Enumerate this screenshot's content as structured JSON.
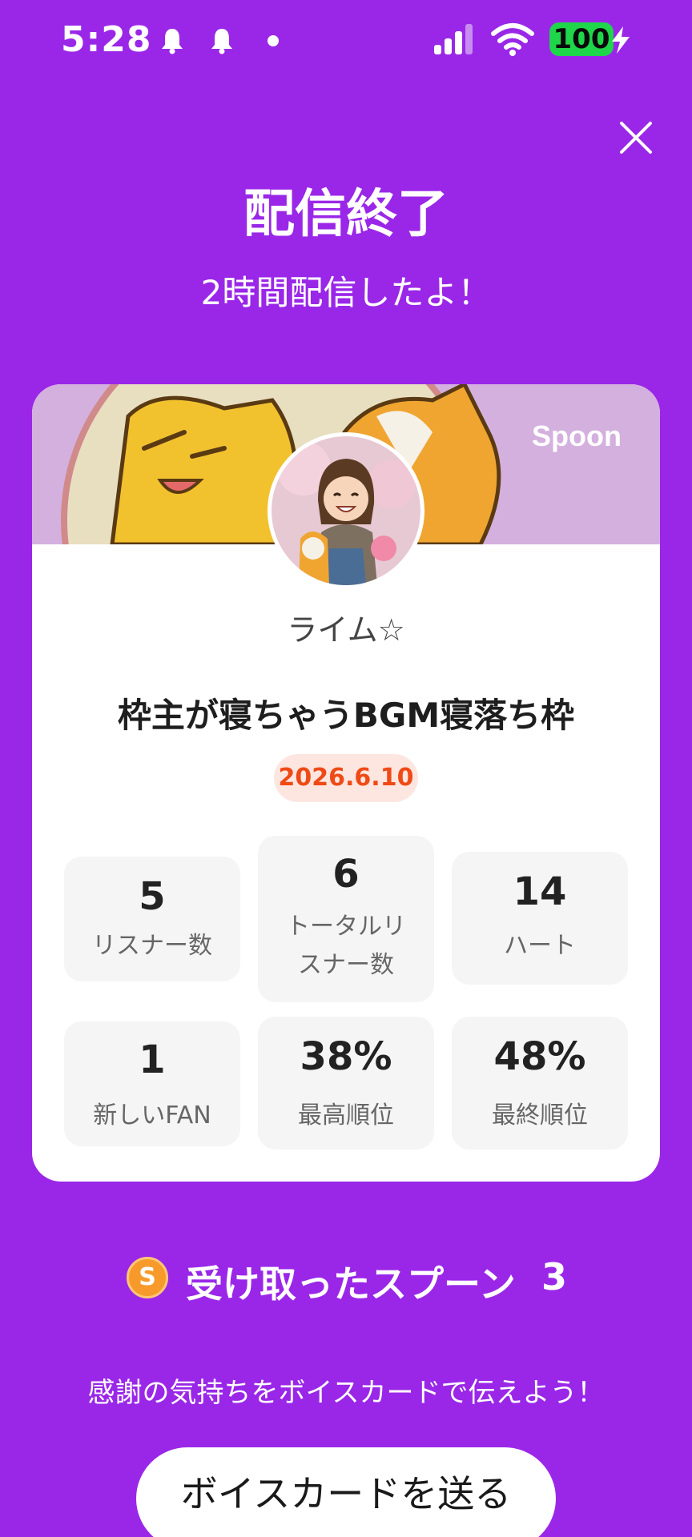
{
  "status_bar": {
    "time": "5:28",
    "battery": "100",
    "icons": [
      "notification-bell-icon",
      "notification-bell-icon",
      "dot-icon",
      "cellular-signal-icon",
      "wifi-icon",
      "battery-icon",
      "charging-bolt-icon"
    ]
  },
  "header": {
    "title": "配信終了",
    "subtitle": "2時間配信したよ！",
    "close_icon": "close-icon"
  },
  "card": {
    "brand": "Spoon",
    "username": "ライム☆",
    "live_title": "枠主が寝ちゃうBGM寝落ち枠",
    "date": "2026.6.10",
    "stats": [
      {
        "value": "5",
        "label": "リスナー数"
      },
      {
        "value": "6",
        "label": "トータルリスナー数"
      },
      {
        "value": "14",
        "label": "ハート"
      },
      {
        "value": "1",
        "label": "新しいFAN"
      },
      {
        "value": "38%",
        "label": "最高順位"
      },
      {
        "value": "48%",
        "label": "最終順位"
      }
    ]
  },
  "spoons": {
    "coin_letter": "S",
    "label": "受け取ったスプーン",
    "count": "3"
  },
  "thanks_text": "感謝の気持ちをボイスカードで伝えよう！",
  "voice_card_button": "ボイスカードを送る",
  "colors": {
    "background": "#9a27e8",
    "card": "#ffffff",
    "date_text": "#ef4a16",
    "date_bg": "#fde6e0",
    "battery": "#1fd54a",
    "spoon_coin": "#f79a2b"
  }
}
